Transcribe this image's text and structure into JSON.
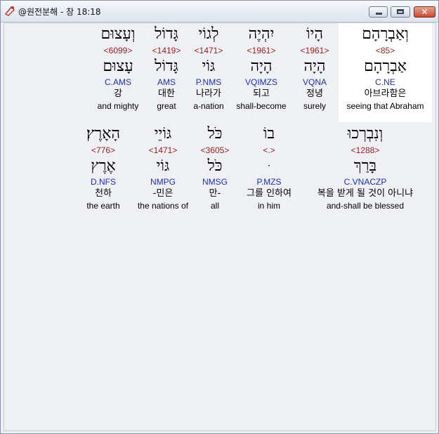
{
  "window": {
    "title": "@원전분해 - 창 18:18",
    "close_glyph": "✕"
  },
  "rows": [
    [
      {
        "heb": "וְאַבְרָהָם",
        "strong": "<85>",
        "lemma": "אַבְרָהָם",
        "morph": "C.NE",
        "kor": "아브라함은",
        "eng": "seeing that Abraham",
        "selected": true
      },
      {
        "heb": "הָיוֹ",
        "strong": "<1961>",
        "lemma": "הָיָה",
        "morph": "VQNA",
        "kor": "정녕",
        "eng": "surely"
      },
      {
        "heb": "יִהְיֶה",
        "strong": "<1961>",
        "lemma": "הָיָה",
        "morph": "VQIMZS",
        "kor": "되고",
        "eng": "shall-become"
      },
      {
        "heb": "לְגוֹי",
        "strong": "<1471>",
        "lemma": "גּוֹי",
        "morph": "P.NMS",
        "kor": "나라가",
        "eng": "a-nation"
      },
      {
        "heb": "גָּדוֹל",
        "strong": "<1419>",
        "lemma": "גָּדוֹל",
        "morph": "AMS",
        "kor": "대한",
        "eng": "great"
      },
      {
        "heb": "וְעָצוּם",
        "strong": "<6099>",
        "lemma": "עָצוּם",
        "morph": "C.AMS",
        "kor": "강",
        "eng": "and mighty"
      }
    ],
    [
      {
        "heb": "וְנִבְרְכוּ",
        "strong": "<1288>",
        "lemma": "בָּרַךְ",
        "morph": "C.VNACZP",
        "kor": "복을 받게 될 것이 아니냐",
        "eng": "and-shall be blessed"
      },
      {
        "heb": "בוֹ",
        "strong": "<.>",
        "lemma": "ּ",
        "morph": "P.MZS",
        "kor": "그를 인하여",
        "eng": "in him"
      },
      {
        "heb": "כֹּל",
        "strong": "<3605>",
        "lemma": "כֹּל",
        "morph": "NMSG",
        "kor": "만-",
        "eng": "all"
      },
      {
        "heb": "גּוֹיֵי",
        "strong": "<1471>",
        "lemma": "גּוֹי",
        "morph": "NMPG",
        "kor": "-민은",
        "eng": "the nations of"
      },
      {
        "heb": "הָאָרֶץ׃",
        "strong": "<776>",
        "lemma": "אֶרֶץ",
        "morph": "D.NFS",
        "kor": "천하",
        "eng": "the earth"
      }
    ]
  ]
}
